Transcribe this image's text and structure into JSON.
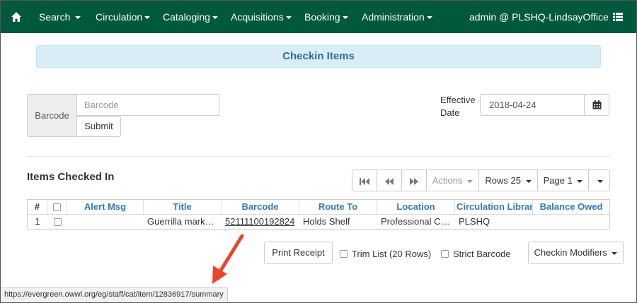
{
  "nav": {
    "items": [
      "Search",
      "Circulation",
      "Cataloging",
      "Acquisitions",
      "Booking",
      "Administration"
    ],
    "user": "admin @ PLSHQ-LindsayOffice",
    "icons": {
      "home": "home-icon",
      "menu": "list-icon"
    },
    "color": "#00593d"
  },
  "panel": {
    "title": "Checkin Items"
  },
  "barcode": {
    "label": "Barcode",
    "placeholder": "Barcode",
    "submit": "Submit"
  },
  "effective_date": {
    "label": "Effective Date",
    "value": "2018-04-24"
  },
  "items": {
    "heading": "Items Checked In",
    "toolbar": {
      "actions": "Actions",
      "rows": "Rows 25",
      "page": "Page 1"
    },
    "columns": [
      "#",
      "",
      "Alert Msg",
      "Title",
      "Barcode",
      "Route To",
      "Location",
      "Circulation Library",
      "Balance Owed"
    ],
    "rows": [
      {
        "num": "1",
        "alert": "",
        "title": "Guerrilla marketing excellence",
        "barcode": "52111100192824",
        "route_to": "Holds Shelf",
        "location": "Professional Collection",
        "library": "PLSHQ",
        "balance": ""
      }
    ]
  },
  "bottom": {
    "print_receipt": "Print Receipt",
    "trim_list": "Trim List (20 Rows)",
    "strict_barcode": "Strict Barcode",
    "checkin_modifiers": "Checkin Modifiers"
  },
  "status_url": "https://evergreen.owwl.org/eg/staff/cat/item/12836917/summary",
  "colors": {
    "accent": "#337ab7",
    "panel_bg": "#d9edf7",
    "arrow": "#e8472e"
  }
}
